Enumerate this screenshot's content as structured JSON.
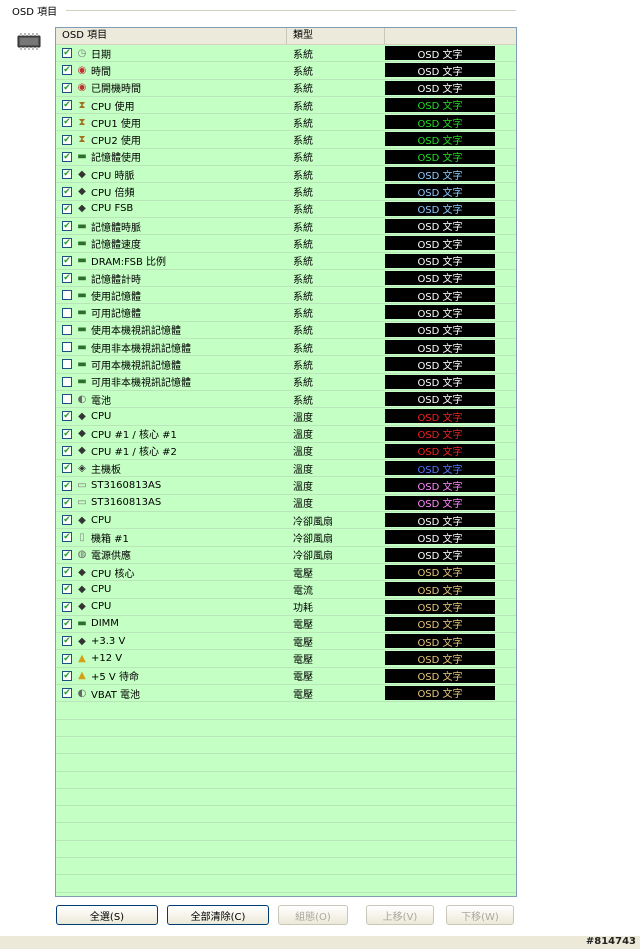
{
  "group_title": "OSD 項目",
  "columns": [
    "OSD 項目",
    "類型",
    ""
  ],
  "rows": [
    {
      "checked": true,
      "icon": "clock-icon",
      "name": "日期",
      "type": "系統",
      "osd": "OSD 文字",
      "color": "#ffffff"
    },
    {
      "checked": true,
      "icon": "stopwatch-icon",
      "name": "時間",
      "type": "系統",
      "osd": "OSD 文字",
      "color": "#ffffff"
    },
    {
      "checked": true,
      "icon": "stopwatch-icon",
      "name": "已開機時間",
      "type": "系統",
      "osd": "OSD 文字",
      "color": "#ffffff"
    },
    {
      "checked": true,
      "icon": "hourglass-icon",
      "name": "CPU 使用",
      "type": "系統",
      "osd": "OSD 文字",
      "color": "#22dd22"
    },
    {
      "checked": true,
      "icon": "hourglass-icon",
      "name": "CPU1 使用",
      "type": "系統",
      "osd": "OSD 文字",
      "color": "#22dd22"
    },
    {
      "checked": true,
      "icon": "hourglass-icon",
      "name": "CPU2 使用",
      "type": "系統",
      "osd": "OSD 文字",
      "color": "#22dd22"
    },
    {
      "checked": true,
      "icon": "memory-icon",
      "name": "記憶體使用",
      "type": "系統",
      "osd": "OSD 文字",
      "color": "#22dd22"
    },
    {
      "checked": true,
      "icon": "cpu-icon",
      "name": "CPU 時脈",
      "type": "系統",
      "osd": "OSD 文字",
      "color": "#8ecbff"
    },
    {
      "checked": true,
      "icon": "cpu-icon",
      "name": "CPU 倍頻",
      "type": "系統",
      "osd": "OSD 文字",
      "color": "#8ecbff"
    },
    {
      "checked": true,
      "icon": "cpu-icon",
      "name": "CPU FSB",
      "type": "系統",
      "osd": "OSD 文字",
      "color": "#8ecbff"
    },
    {
      "checked": true,
      "icon": "memory-icon",
      "name": "記憶體時脈",
      "type": "系統",
      "osd": "OSD 文字",
      "color": "#ffffff"
    },
    {
      "checked": true,
      "icon": "memory-icon",
      "name": "記憶體速度",
      "type": "系統",
      "osd": "OSD 文字",
      "color": "#ffffff"
    },
    {
      "checked": true,
      "icon": "memory-icon",
      "name": "DRAM:FSB 比例",
      "type": "系統",
      "osd": "OSD 文字",
      "color": "#ffffff"
    },
    {
      "checked": true,
      "icon": "memory-icon",
      "name": "記憶體計時",
      "type": "系統",
      "osd": "OSD 文字",
      "color": "#ffffff"
    },
    {
      "checked": false,
      "icon": "memory-icon",
      "name": "使用記憶體",
      "type": "系統",
      "osd": "OSD 文字",
      "color": "#ffffff"
    },
    {
      "checked": false,
      "icon": "memory-icon",
      "name": "可用記憶體",
      "type": "系統",
      "osd": "OSD 文字",
      "color": "#ffffff"
    },
    {
      "checked": false,
      "icon": "memory-icon",
      "name": "使用本機視訊記憶體",
      "type": "系統",
      "osd": "OSD 文字",
      "color": "#ffffff"
    },
    {
      "checked": false,
      "icon": "memory-icon",
      "name": "使用非本機視訊記憶體",
      "type": "系統",
      "osd": "OSD 文字",
      "color": "#ffffff"
    },
    {
      "checked": false,
      "icon": "memory-icon",
      "name": "可用本機視訊記憶體",
      "type": "系統",
      "osd": "OSD 文字",
      "color": "#ffffff"
    },
    {
      "checked": false,
      "icon": "memory-icon",
      "name": "可用非本機視訊記憶體",
      "type": "系統",
      "osd": "OSD 文字",
      "color": "#ffffff"
    },
    {
      "checked": false,
      "icon": "battery-icon",
      "name": "電池",
      "type": "系統",
      "osd": "OSD 文字",
      "color": "#ffffff"
    },
    {
      "checked": true,
      "icon": "cpu-icon",
      "name": "CPU",
      "type": "溫度",
      "osd": "OSD 文字",
      "color": "#ee2222"
    },
    {
      "checked": true,
      "icon": "cpu-icon",
      "name": "CPU #1 / 核心 #1",
      "type": "溫度",
      "osd": "OSD 文字",
      "color": "#ee2222"
    },
    {
      "checked": true,
      "icon": "cpu-icon",
      "name": "CPU #1 / 核心 #2",
      "type": "溫度",
      "osd": "OSD 文字",
      "color": "#ee2222"
    },
    {
      "checked": true,
      "icon": "motherboard-icon",
      "name": "主機板",
      "type": "溫度",
      "osd": "OSD 文字",
      "color": "#5577ff"
    },
    {
      "checked": true,
      "icon": "harddisk-icon",
      "name": "ST3160813AS",
      "type": "溫度",
      "osd": "OSD 文字",
      "color": "#ff88ff"
    },
    {
      "checked": true,
      "icon": "harddisk-icon",
      "name": "ST3160813AS",
      "type": "溫度",
      "osd": "OSD 文字",
      "color": "#ff88ff"
    },
    {
      "checked": true,
      "icon": "cpu-icon",
      "name": "CPU",
      "type": "冷卻風扇",
      "osd": "OSD 文字",
      "color": "#ffffff"
    },
    {
      "checked": true,
      "icon": "case-icon",
      "name": "機箱 #1",
      "type": "冷卻風扇",
      "osd": "OSD 文字",
      "color": "#ffffff"
    },
    {
      "checked": true,
      "icon": "power-supply-icon",
      "name": "電源供應",
      "type": "冷卻風扇",
      "osd": "OSD 文字",
      "color": "#ffffff"
    },
    {
      "checked": true,
      "icon": "cpu-icon",
      "name": "CPU 核心",
      "type": "電壓",
      "osd": "OSD 文字",
      "color": "#e8c77a"
    },
    {
      "checked": true,
      "icon": "cpu-icon",
      "name": "CPU",
      "type": "電流",
      "osd": "OSD 文字",
      "color": "#e8c77a"
    },
    {
      "checked": true,
      "icon": "cpu-icon",
      "name": "CPU",
      "type": "功耗",
      "osd": "OSD 文字",
      "color": "#e8c77a"
    },
    {
      "checked": true,
      "icon": "memory-icon",
      "name": "DIMM",
      "type": "電壓",
      "osd": "OSD 文字",
      "color": "#e8c77a"
    },
    {
      "checked": true,
      "icon": "cpu-icon",
      "name": "+3.3 V",
      "type": "電壓",
      "osd": "OSD 文字",
      "color": "#e8c77a"
    },
    {
      "checked": true,
      "icon": "warning-icon",
      "name": "+12 V",
      "type": "電壓",
      "osd": "OSD 文字",
      "color": "#e8c77a"
    },
    {
      "checked": true,
      "icon": "warning-icon",
      "name": "+5 V 待命",
      "type": "電壓",
      "osd": "OSD 文字",
      "color": "#e8c77a"
    },
    {
      "checked": true,
      "icon": "battery-icon",
      "name": "VBAT 電池",
      "type": "電壓",
      "osd": "OSD 文字",
      "color": "#e8c77a"
    }
  ],
  "buttons": {
    "select_all": "全選(S)",
    "clear_all": "全部清除(C)",
    "configure": "組態(O)",
    "move_up": "上移(V)",
    "move_down": "下移(W)"
  },
  "watermark": "#814743"
}
